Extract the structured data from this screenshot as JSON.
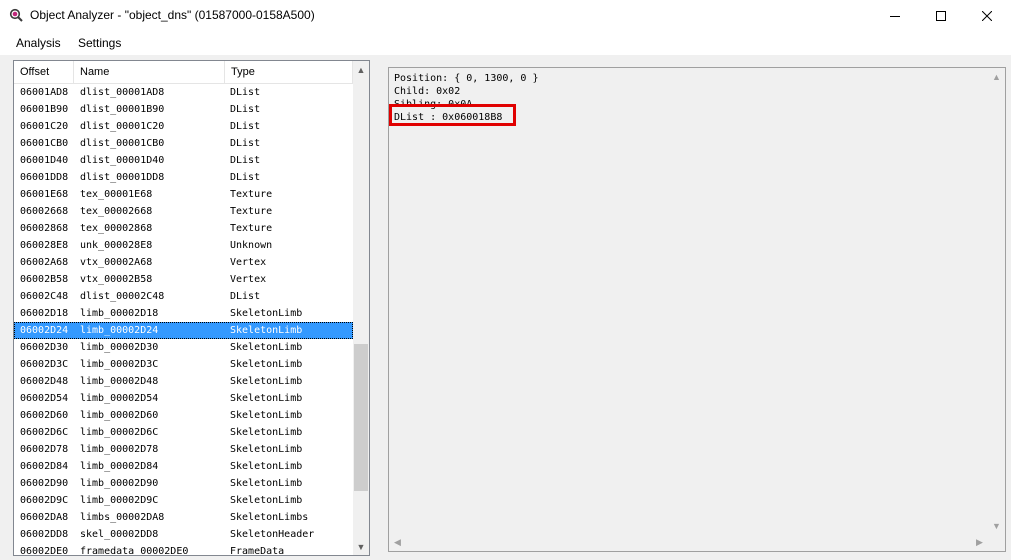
{
  "window": {
    "title": "Object Analyzer - \"object_dns\" (01587000-0158A500)",
    "icon": "magnifier-app-icon",
    "controls": {
      "minimize": "minimize-icon",
      "maximize": "maximize-icon",
      "close": "close-icon"
    }
  },
  "menu": {
    "items": [
      "Analysis",
      "Settings"
    ]
  },
  "list": {
    "columns": [
      "Offset",
      "Name",
      "Type"
    ],
    "selected_index": 14,
    "rows": [
      {
        "offset": "06001AD8",
        "name": "dlist_00001AD8",
        "type": "DList"
      },
      {
        "offset": "06001B90",
        "name": "dlist_00001B90",
        "type": "DList"
      },
      {
        "offset": "06001C20",
        "name": "dlist_00001C20",
        "type": "DList"
      },
      {
        "offset": "06001CB0",
        "name": "dlist_00001CB0",
        "type": "DList"
      },
      {
        "offset": "06001D40",
        "name": "dlist_00001D40",
        "type": "DList"
      },
      {
        "offset": "06001DD8",
        "name": "dlist_00001DD8",
        "type": "DList"
      },
      {
        "offset": "06001E68",
        "name": "tex_00001E68",
        "type": "Texture"
      },
      {
        "offset": "06002668",
        "name": "tex_00002668",
        "type": "Texture"
      },
      {
        "offset": "06002868",
        "name": "tex_00002868",
        "type": "Texture"
      },
      {
        "offset": "060028E8",
        "name": "unk_000028E8",
        "type": "Unknown"
      },
      {
        "offset": "06002A68",
        "name": "vtx_00002A68",
        "type": "Vertex"
      },
      {
        "offset": "06002B58",
        "name": "vtx_00002B58",
        "type": "Vertex"
      },
      {
        "offset": "06002C48",
        "name": "dlist_00002C48",
        "type": "DList"
      },
      {
        "offset": "06002D18",
        "name": "limb_00002D18",
        "type": "SkeletonLimb"
      },
      {
        "offset": "06002D24",
        "name": "limb_00002D24",
        "type": "SkeletonLimb"
      },
      {
        "offset": "06002D30",
        "name": "limb_00002D30",
        "type": "SkeletonLimb"
      },
      {
        "offset": "06002D3C",
        "name": "limb_00002D3C",
        "type": "SkeletonLimb"
      },
      {
        "offset": "06002D48",
        "name": "limb_00002D48",
        "type": "SkeletonLimb"
      },
      {
        "offset": "06002D54",
        "name": "limb_00002D54",
        "type": "SkeletonLimb"
      },
      {
        "offset": "06002D60",
        "name": "limb_00002D60",
        "type": "SkeletonLimb"
      },
      {
        "offset": "06002D6C",
        "name": "limb_00002D6C",
        "type": "SkeletonLimb"
      },
      {
        "offset": "06002D78",
        "name": "limb_00002D78",
        "type": "SkeletonLimb"
      },
      {
        "offset": "06002D84",
        "name": "limb_00002D84",
        "type": "SkeletonLimb"
      },
      {
        "offset": "06002D90",
        "name": "limb_00002D90",
        "type": "SkeletonLimb"
      },
      {
        "offset": "06002D9C",
        "name": "limb_00002D9C",
        "type": "SkeletonLimb"
      },
      {
        "offset": "06002DA8",
        "name": "limbs_00002DA8",
        "type": "SkeletonLimbs"
      },
      {
        "offset": "06002DD8",
        "name": "skel_00002DD8",
        "type": "SkeletonHeader"
      },
      {
        "offset": "06002DE0",
        "name": "framedata_00002DE0",
        "type": "FrameData"
      }
    ]
  },
  "detail": {
    "lines": [
      "Position: { 0, 1300, 0 }",
      "Child: 0x02",
      "Sibling: 0x0A",
      "DList : 0x060018B8"
    ],
    "highlighted_line_index": 3,
    "highlight_color": "#e00000"
  },
  "colors": {
    "selection": "#3399ff",
    "client_background": "#f0f0f0"
  }
}
